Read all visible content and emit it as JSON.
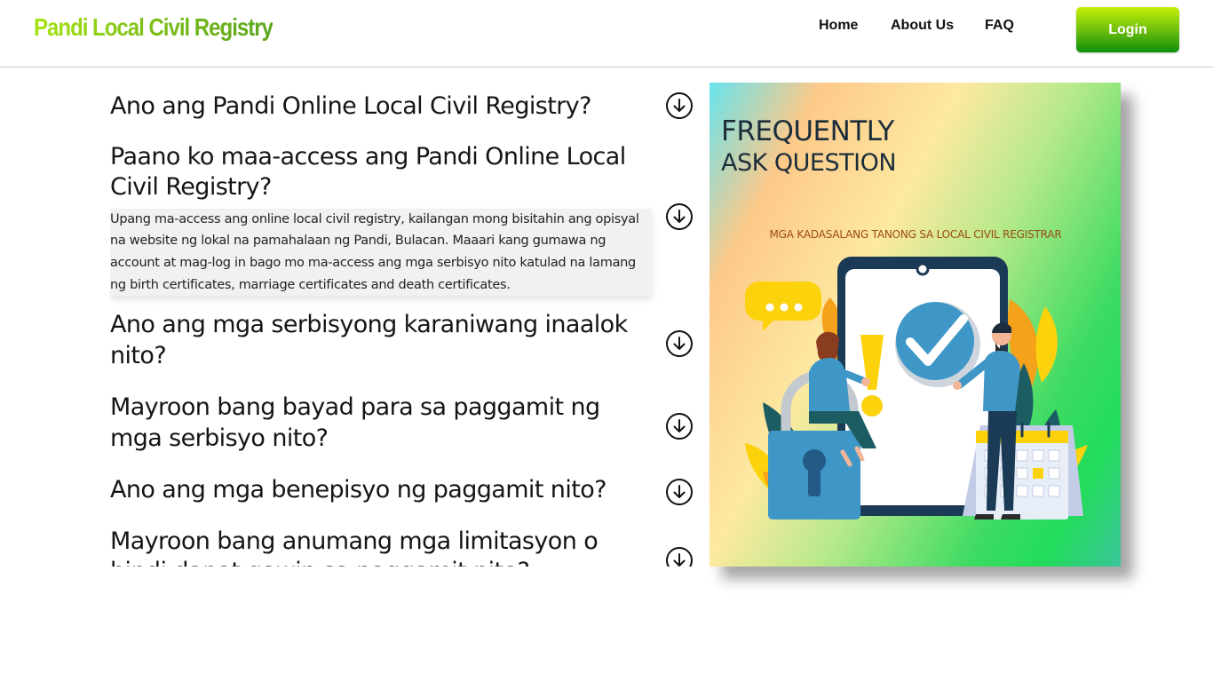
{
  "header": {
    "brand": "Pandi Local Civil Registry",
    "nav": {
      "home": "Home",
      "about": "About Us",
      "faq": "FAQ"
    },
    "login_label": "Login"
  },
  "faq": {
    "items": [
      {
        "question": "Ano ang Pandi Online Local Civil Registry?"
      },
      {
        "question": "Paano ko maa-access ang Pandi Online Local Civil Registry?",
        "answer": "Upang ma-access ang online local civil registry, kailangan mong bisitahin ang opisyal na website ng lokal na pamahalaan ng Pandi, Bulacan. Maaari kang gumawa ng account at mag-log in bago mo ma-access ang mga serbisyo nito katulad na lamang ng birth certificates, marriage certificates and death certificates."
      },
      {
        "question": "Ano ang mga serbisyong karaniwang inaalok nito?"
      },
      {
        "question": "Mayroon bang bayad para sa paggamit ng mga serbisyo nito?"
      },
      {
        "question": "Ano ang mga benepisyo ng paggamit nito?"
      },
      {
        "question": "Mayroon bang anumang mga limitasyon o hindi dapat gawin sa paggamit nito?"
      }
    ]
  },
  "hero": {
    "title_line1": "FREQUENTLY",
    "title_line2": "ASK QUESTION",
    "subtitle": "MGA KADASALANG TANONG SA LOCAL CIVIL REGISTRAR"
  },
  "icons": {
    "toggle": "arrow-down-circle-icon"
  },
  "colors": {
    "brand_text": "#8fd112",
    "login_top": "#c5f006",
    "login_bottom": "#0d8f0c",
    "answer_bg": "#f1f1f1"
  }
}
